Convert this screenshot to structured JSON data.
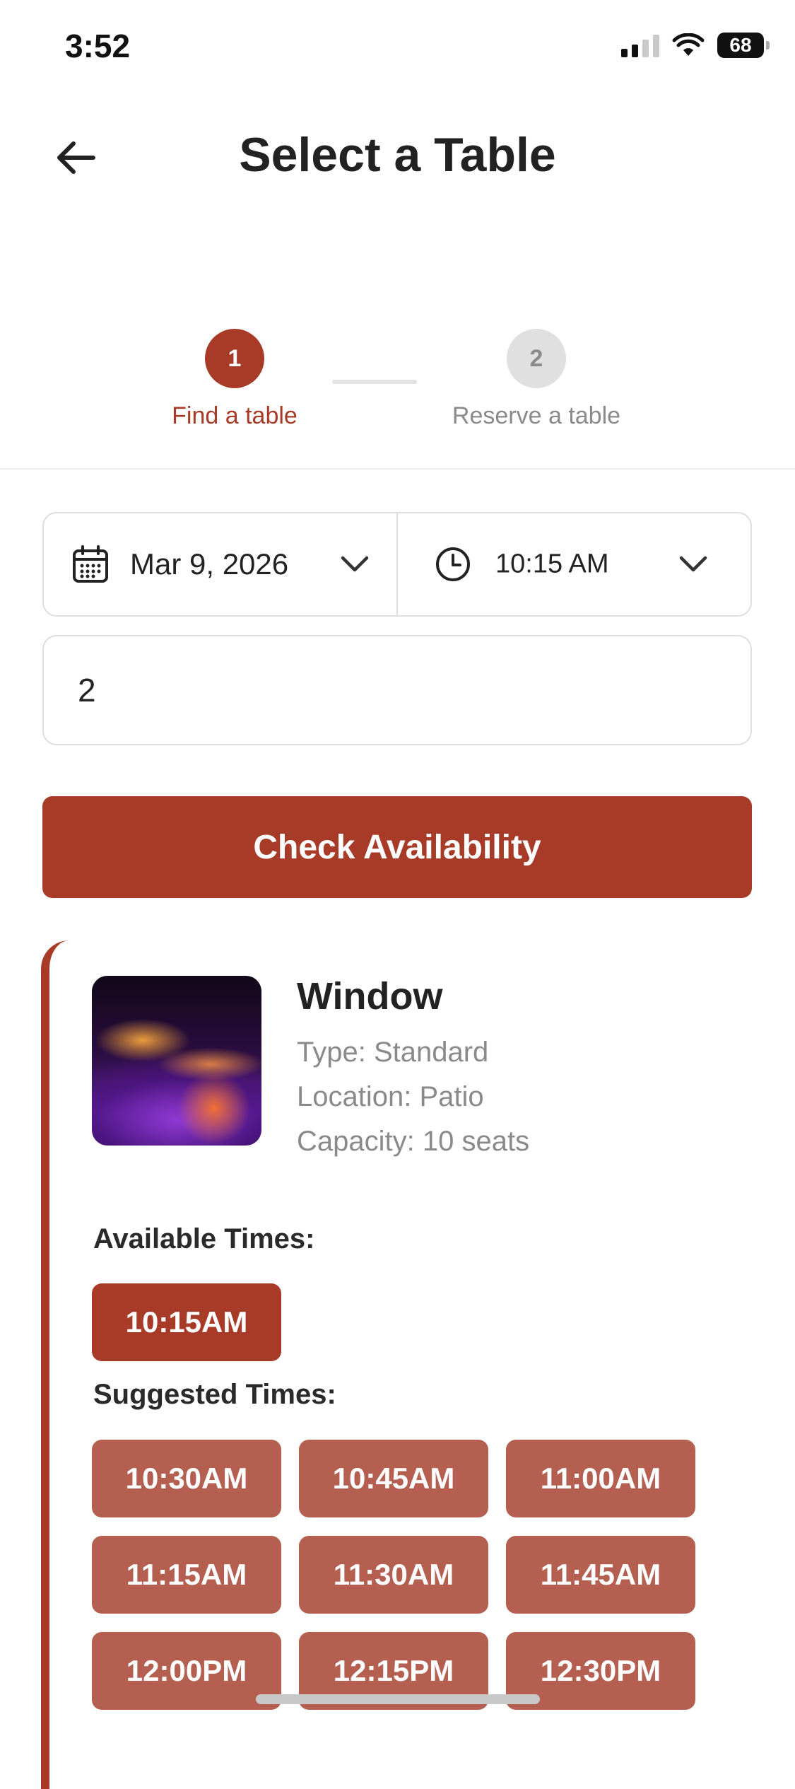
{
  "status_bar": {
    "time": "3:52",
    "battery": "68"
  },
  "header": {
    "title": "Select a Table"
  },
  "stepper": {
    "steps": [
      {
        "number": "1",
        "label": "Find a table"
      },
      {
        "number": "2",
        "label": "Reserve a table"
      }
    ],
    "active_step": 1
  },
  "search": {
    "date": "Mar 9, 2026",
    "time": "10:15 AM",
    "party_size": "2",
    "check_button": "Check Availability"
  },
  "result": {
    "name": "Window",
    "type": "Type: Standard",
    "location": "Location: Patio",
    "capacity": "Capacity: 10 seats",
    "available_label": "Available Times:",
    "available_times": [
      "10:15AM"
    ],
    "suggested_label": "Suggested Times:",
    "suggested_times": [
      "10:30AM",
      "10:45AM",
      "11:00AM",
      "11:15AM",
      "11:30AM",
      "11:45AM",
      "12:00PM",
      "12:15PM",
      "12:30PM"
    ]
  },
  "colors": {
    "accent": "#a83b27",
    "suggested_chip": "#b55f51",
    "muted_text": "#8a8a8a"
  }
}
